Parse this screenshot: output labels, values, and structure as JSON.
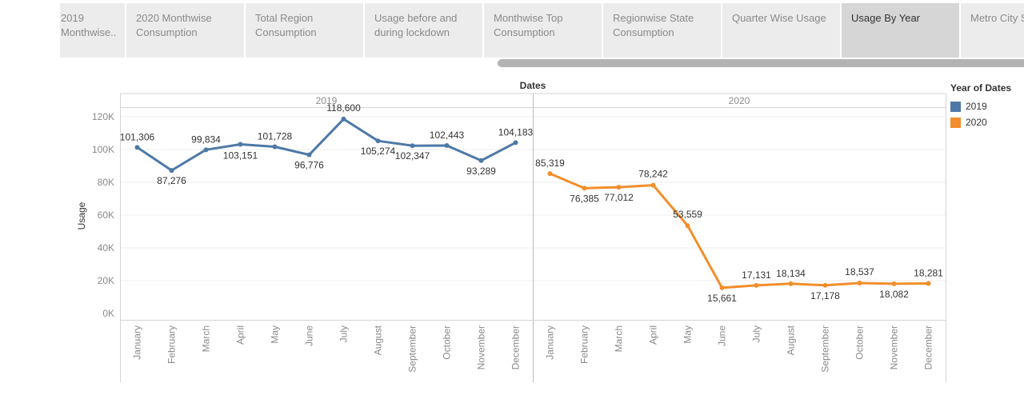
{
  "tabs": [
    {
      "label": "2019 Monthwise..",
      "active": false
    },
    {
      "label": "2020 Monthwise Consumption",
      "active": false
    },
    {
      "label": "Total Region Consumption",
      "active": false
    },
    {
      "label": "Usage before and during lockdown",
      "active": false
    },
    {
      "label": "Monthwise Top Consumption",
      "active": false
    },
    {
      "label": "Regionwise State Consumption",
      "active": false
    },
    {
      "label": "Quarter Wise Usage",
      "active": false
    },
    {
      "label": "Usage By Year",
      "active": true
    },
    {
      "label": "Metro City S",
      "active": false
    }
  ],
  "legend": {
    "title": "Year of Dates",
    "items": [
      {
        "label": "2019",
        "color": "#4e79a7"
      },
      {
        "label": "2020",
        "color": "#f28e2b"
      }
    ]
  },
  "chart_data": {
    "type": "line",
    "title": "",
    "column_header": "Dates",
    "ylabel": "Usage",
    "ylim": [
      0,
      125000
    ],
    "yticks": [
      {
        "value": 0,
        "label": "0K"
      },
      {
        "value": 20000,
        "label": "20K"
      },
      {
        "value": 40000,
        "label": "40K"
      },
      {
        "value": 60000,
        "label": "60K"
      },
      {
        "value": 80000,
        "label": "80K"
      },
      {
        "value": 100000,
        "label": "100K"
      },
      {
        "value": 120000,
        "label": "120K"
      }
    ],
    "grid": true,
    "legend_position": "right",
    "categories": [
      "January",
      "February",
      "March",
      "April",
      "May",
      "June",
      "July",
      "August",
      "September",
      "October",
      "November",
      "December"
    ],
    "panels": [
      {
        "name": "2019",
        "color": "#4e79a7",
        "values": [
          101306,
          87276,
          99834,
          103151,
          101728,
          96776,
          118600,
          105274,
          102347,
          102443,
          93289,
          104183
        ],
        "labels": [
          "101,306",
          "87,276",
          "99,834",
          "103,151",
          "101,728",
          "96,776",
          "118,600",
          "105,274",
          "102,347",
          "102,443",
          "93,289",
          "104,183"
        ]
      },
      {
        "name": "2020",
        "color": "#f28e2b",
        "values": [
          85319,
          76385,
          77012,
          78242,
          53559,
          15661,
          17131,
          18134,
          17178,
          18537,
          18082,
          18281
        ],
        "labels": [
          "85,319",
          "76,385",
          "77,012",
          "78,242",
          "53,559",
          "15,661",
          "17,131",
          "18,134",
          "17,178",
          "18,537",
          "18,082",
          "18,281"
        ]
      }
    ]
  }
}
